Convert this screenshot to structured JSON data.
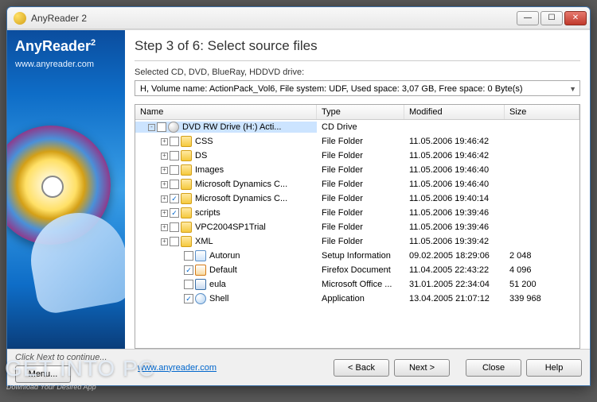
{
  "window": {
    "title": "AnyReader 2"
  },
  "sidebar": {
    "title": "AnyReader",
    "sup": "2",
    "link": "www.anyreader.com"
  },
  "main": {
    "step_title": "Step 3 of 6: Select source files",
    "drive_label": "Selected CD, DVD, BlueRay, HDDVD drive:",
    "drive_value": "H, Volume name: ActionPack_Vol6, File system: UDF, Used space: 3,07 GB, Free space: 0 Byte(s)",
    "columns": {
      "name": "Name",
      "type": "Type",
      "modified": "Modified",
      "size": "Size"
    },
    "rows": [
      {
        "indent": 0,
        "expand": "-",
        "checked": false,
        "icon": "drive",
        "name": "DVD RW Drive (H:) Acti...",
        "type": "CD Drive",
        "modified": "",
        "size": "",
        "selected": true
      },
      {
        "indent": 1,
        "expand": "+",
        "checked": false,
        "icon": "folder",
        "name": "CSS",
        "type": "File Folder",
        "modified": "11.05.2006 19:46:42",
        "size": ""
      },
      {
        "indent": 1,
        "expand": "+",
        "checked": false,
        "icon": "folder",
        "name": "DS",
        "type": "File Folder",
        "modified": "11.05.2006 19:46:42",
        "size": ""
      },
      {
        "indent": 1,
        "expand": "+",
        "checked": false,
        "icon": "folder",
        "name": "Images",
        "type": "File Folder",
        "modified": "11.05.2006 19:46:40",
        "size": ""
      },
      {
        "indent": 1,
        "expand": "+",
        "checked": false,
        "icon": "folder",
        "name": "Microsoft Dynamics C...",
        "type": "File Folder",
        "modified": "11.05.2006 19:46:40",
        "size": ""
      },
      {
        "indent": 1,
        "expand": "+",
        "checked": true,
        "icon": "folder",
        "name": "Microsoft Dynamics C...",
        "type": "File Folder",
        "modified": "11.05.2006 19:40:14",
        "size": ""
      },
      {
        "indent": 1,
        "expand": "+",
        "checked": true,
        "icon": "folder",
        "name": "scripts",
        "type": "File Folder",
        "modified": "11.05.2006 19:39:46",
        "size": ""
      },
      {
        "indent": 1,
        "expand": "+",
        "checked": false,
        "icon": "folder",
        "name": "VPC2004SP1Trial",
        "type": "File Folder",
        "modified": "11.05.2006 19:39:46",
        "size": ""
      },
      {
        "indent": 1,
        "expand": "+",
        "checked": false,
        "icon": "folder",
        "name": "XML",
        "type": "File Folder",
        "modified": "11.05.2006 19:39:42",
        "size": ""
      },
      {
        "indent": 2,
        "expand": "",
        "checked": false,
        "icon": "file-html",
        "name": "Autorun",
        "type": "Setup Information",
        "modified": "09.02.2005 18:29:06",
        "size": "2 048"
      },
      {
        "indent": 2,
        "expand": "",
        "checked": true,
        "icon": "file-ff",
        "name": "Default",
        "type": "Firefox Document",
        "modified": "11.04.2005 22:43:22",
        "size": "4 096"
      },
      {
        "indent": 2,
        "expand": "",
        "checked": false,
        "icon": "file-doc",
        "name": "eula",
        "type": "Microsoft Office ...",
        "modified": "31.01.2005 22:34:04",
        "size": "51 200"
      },
      {
        "indent": 2,
        "expand": "",
        "checked": true,
        "icon": "file-app",
        "name": "Shell",
        "type": "Application",
        "modified": "13.04.2005 21:07:12",
        "size": "339 968"
      }
    ]
  },
  "footer": {
    "hint": "Click Next to continue...",
    "link": "www.anyreader.com",
    "menu": "Menu...",
    "back": "< Back",
    "next": "Next >",
    "close": "Close",
    "help": "Help"
  },
  "watermark": {
    "big": "GET INTO PC",
    "small": "Download Your Desired App"
  }
}
